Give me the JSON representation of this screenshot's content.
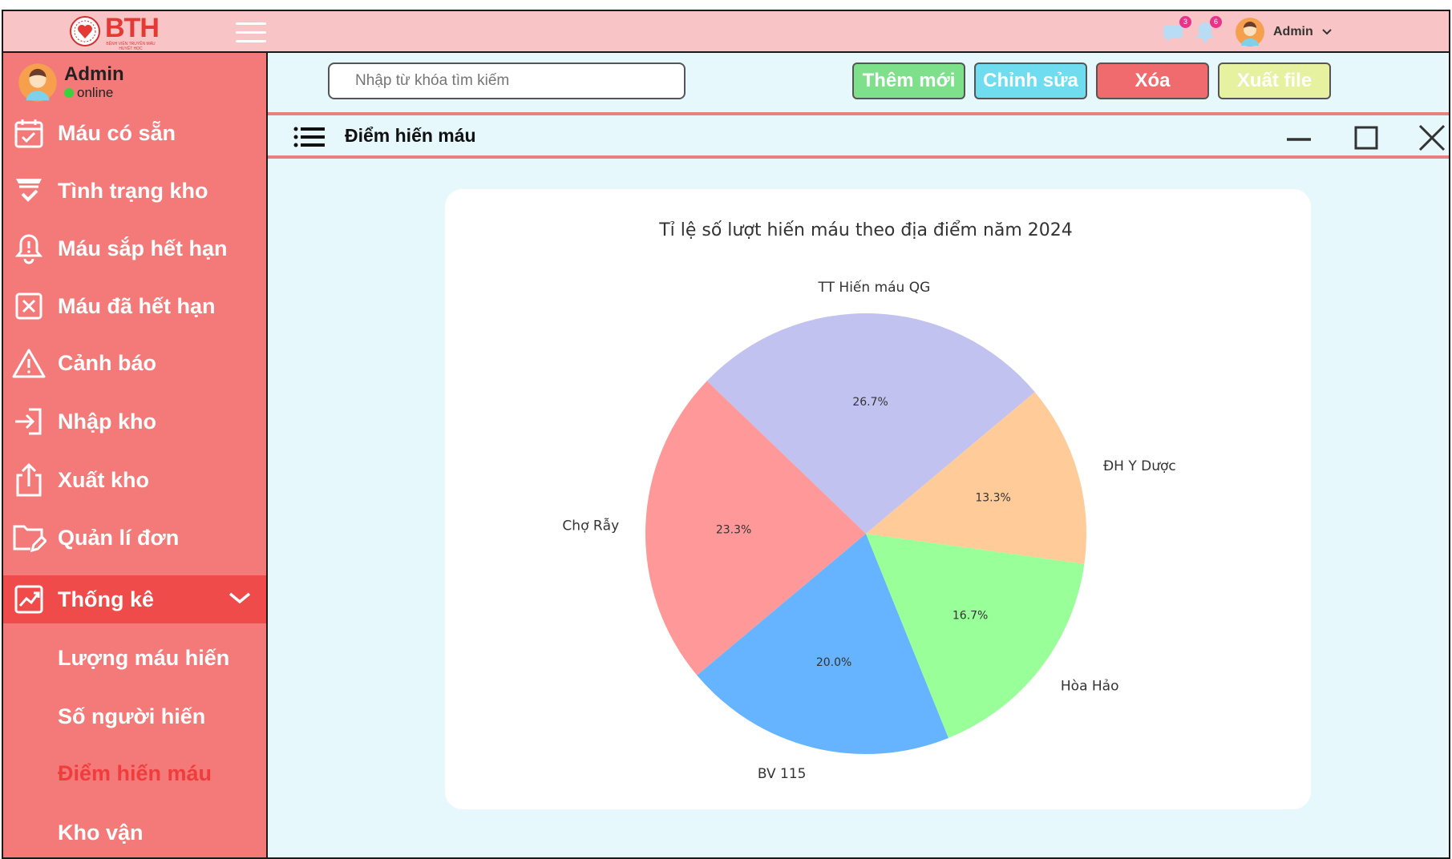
{
  "header": {
    "logo_text": "BTH",
    "logo_subtitle": "BỆNH VIỆN TRUYỀN MÁU HUYẾT HỌC",
    "notifications": [
      {
        "icon": "chat-icon",
        "count": "3"
      },
      {
        "icon": "bell-icon",
        "count": "6"
      }
    ],
    "user_name": "Admin"
  },
  "sidebar": {
    "user": {
      "name": "Admin",
      "status": "online"
    },
    "items": [
      {
        "label": "Máu có sẵn",
        "icon": "calendar-check-icon"
      },
      {
        "label": "Tình trạng kho",
        "icon": "filter-check-icon"
      },
      {
        "label": "Máu sắp hết hạn",
        "icon": "bell-alert-icon"
      },
      {
        "label": "Máu đã hết hạn",
        "icon": "x-box-icon"
      },
      {
        "label": "Cảnh báo",
        "icon": "warning-icon"
      },
      {
        "label": "Nhập kho",
        "icon": "import-icon"
      },
      {
        "label": "Xuất kho",
        "icon": "export-icon"
      },
      {
        "label": "Quản lí đơn",
        "icon": "folder-edit-icon"
      },
      {
        "label": "Thống kê",
        "icon": "chart-icon"
      }
    ],
    "subitems": [
      "Lượng máu hiến",
      "Số người hiến",
      "Điểm hiến máu",
      "Kho vận"
    ]
  },
  "toolbar": {
    "search_placeholder": "Nhập từ khóa tìm kiếm",
    "add_label": "Thêm mới",
    "edit_label": "Chỉnh sửa",
    "delete_label": "Xóa",
    "export_label": "Xuất file"
  },
  "window": {
    "title": "Điểm hiến máu"
  },
  "colors": {
    "add": "#7ee08a",
    "edit": "#6fdcef",
    "delete": "#f06b6e",
    "export": "#e6f2a0"
  },
  "chart_data": {
    "type": "pie",
    "title": "Tỉ lệ số lượt hiến máu theo địa điểm năm 2024",
    "slices": [
      {
        "label": "TT Hiến máu QG",
        "value": 26.7,
        "text": "26.7%",
        "color": "#c2c2f0"
      },
      {
        "label": "Chợ Rẫy",
        "value": 23.3,
        "text": "23.3%",
        "color": "#ff9999"
      },
      {
        "label": "BV 115",
        "value": 20.0,
        "text": "20.0%",
        "color": "#66b3ff"
      },
      {
        "label": "Hòa Hảo",
        "value": 16.7,
        "text": "16.7%",
        "color": "#99ff99"
      },
      {
        "label": "ĐH Y Dược",
        "value": 13.3,
        "text": "13.3%",
        "color": "#ffcc99"
      }
    ]
  }
}
